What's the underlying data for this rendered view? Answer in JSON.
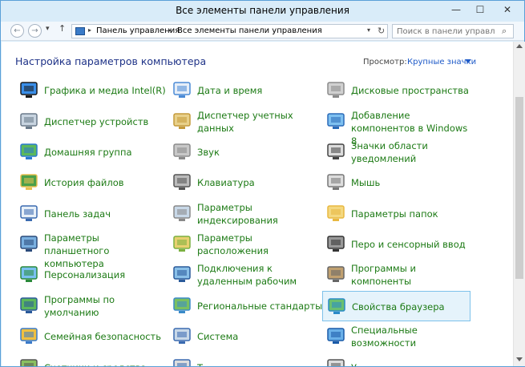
{
  "window": {
    "title": "Все элементы панели управления",
    "minimize": "—",
    "maximize": "☐",
    "close": "✕"
  },
  "nav": {
    "back": "←",
    "forward": "→",
    "recent": "▾",
    "up": "↑",
    "crumb_sep": "▸",
    "breadcrumbs": [
      "Панель управления",
      "Все элементы панели управления"
    ],
    "dropdown": "▾",
    "refresh": "↻"
  },
  "search": {
    "placeholder": "Поиск в панели управления",
    "icon": "⌕"
  },
  "header": {
    "title": "Настройка параметров компьютера",
    "view_label": "Просмотр:",
    "view_value": "Крупные значки"
  },
  "colors": {
    "link": "#1c7a14",
    "heading": "#1e3287",
    "accent": "#1e5ac8"
  },
  "items": [
    {
      "label": "Графика и медиа Intel(R)",
      "icon": "intel-graphics-icon"
    },
    {
      "label": "Дата и время",
      "icon": "calendar-clock-icon"
    },
    {
      "label": "Дисковые пространства",
      "icon": "storage-spaces-icon"
    },
    {
      "label": "Диспетчер устройств",
      "icon": "device-manager-icon"
    },
    {
      "label": "Диспетчер учетных данных",
      "icon": "credential-vault-icon"
    },
    {
      "label": "Добавление компонентов в Windows 8",
      "icon": "add-features-icon"
    },
    {
      "label": "Домашняя группа",
      "icon": "homegroup-icon"
    },
    {
      "label": "Звук",
      "icon": "speaker-icon"
    },
    {
      "label": "Значки области уведомлений",
      "icon": "notification-area-icon"
    },
    {
      "label": "История файлов",
      "icon": "file-history-icon"
    },
    {
      "label": "Клавиатура",
      "icon": "keyboard-icon"
    },
    {
      "label": "Мышь",
      "icon": "mouse-icon"
    },
    {
      "label": "Панель задач",
      "icon": "taskbar-icon"
    },
    {
      "label": "Параметры индексирования",
      "icon": "indexing-icon"
    },
    {
      "label": "Параметры папок",
      "icon": "folder-options-icon"
    },
    {
      "label": "Параметры планшетного компьютера",
      "icon": "tablet-icon"
    },
    {
      "label": "Параметры расположения",
      "icon": "location-icon"
    },
    {
      "label": "Перо и сенсорный ввод",
      "icon": "pen-icon"
    },
    {
      "label": "Персонализация",
      "icon": "personalization-icon"
    },
    {
      "label": "Подключения к удаленным рабочим",
      "icon": "remote-desktop-icon"
    },
    {
      "label": "Программы и компоненты",
      "icon": "programs-icon"
    },
    {
      "label": "Программы по умолчанию",
      "icon": "default-programs-icon"
    },
    {
      "label": "Региональные стандарты",
      "icon": "region-globe-icon"
    },
    {
      "label": "Свойства браузера",
      "icon": "internet-options-icon"
    },
    {
      "label": "Семейная безопасность",
      "icon": "family-safety-icon"
    },
    {
      "label": "Система",
      "icon": "system-icon"
    },
    {
      "label": "Специальные возможности",
      "icon": "ease-of-access-icon"
    },
    {
      "label": "Счетчики и средства",
      "icon": "performance-icon"
    },
    {
      "label": "Т",
      "icon": "troubleshooting-icon"
    },
    {
      "label": "У",
      "icon": "user-accounts-icon"
    }
  ],
  "scrollbar": {
    "position": 0.35
  }
}
